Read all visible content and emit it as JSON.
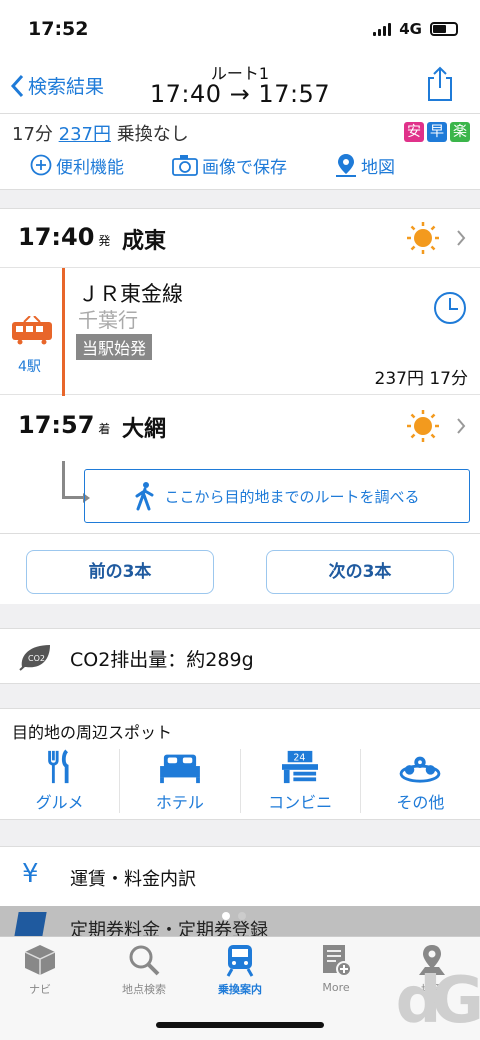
{
  "status": {
    "time": "17:52",
    "network": "4G"
  },
  "nav": {
    "back_label": "検索結果",
    "title": "ルート1",
    "subtitle": "17:40 → 17:57"
  },
  "summary": {
    "duration": "17分",
    "fare": "237円",
    "transfer": "乗換なし",
    "badges": [
      "安",
      "早",
      "楽"
    ],
    "badge_colors": [
      "#e0318a",
      "#1f7bd8",
      "#3bb54a"
    ]
  },
  "actions": {
    "convenience": "便利機能",
    "save_image": "画像で保存",
    "map": "地図"
  },
  "route": {
    "departure": {
      "time": "17:40",
      "suffix": "発",
      "station": "成東"
    },
    "segment": {
      "line": "ＪＲ東金線",
      "direction": "千葉行",
      "tag": "当駅始発",
      "stops": "4駅",
      "fare_time": "237円 17分"
    },
    "arrival": {
      "time": "17:57",
      "suffix": "着",
      "station": "大網"
    },
    "walk_label": "ここから目的地までのルートを調べる"
  },
  "paging": {
    "prev": "前の3本",
    "next": "次の3本"
  },
  "co2": {
    "icon_text": "CO2",
    "label": "CO2排出量：約289g"
  },
  "spots": {
    "header": "目的地の周辺スポット",
    "items": [
      "グルメ",
      "ホテル",
      "コンビニ",
      "その他"
    ],
    "conv_badge": "24"
  },
  "fare_breakdown": {
    "symbol": "¥",
    "label": "運賃・料金内訳"
  },
  "teiki": {
    "label": "定期券料金・定期券登録"
  },
  "tabs": [
    "ナビ",
    "地点検索",
    "乗換案内",
    "More",
    "地図"
  ],
  "watermark": "dG",
  "colors": {
    "accent": "#1f7bd8",
    "rail": "#e8662a",
    "sun": "#f39a1e"
  }
}
